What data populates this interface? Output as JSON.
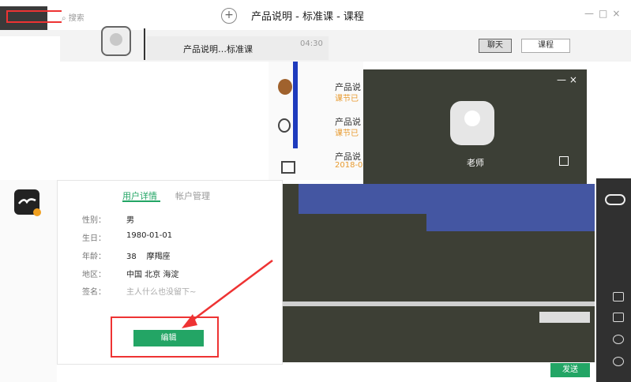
{
  "search": {
    "placeholder": "搜索"
  },
  "window": {
    "title": "产品说明 - 标准课 - 课程"
  },
  "conversation": {
    "name": "产品说明…标准课",
    "time": "04:30"
  },
  "header_tabs": [
    "聊天",
    "课程"
  ],
  "list_items": [
    {
      "title": "产品说",
      "sub": "课节已"
    },
    {
      "title": "产品说",
      "sub": "课节已"
    },
    {
      "title": "产品说",
      "sub": "2018-0"
    }
  ],
  "video": {
    "name": "老师",
    "controls": "— ×"
  },
  "profile": {
    "tabs": {
      "detail": "用户详情",
      "account": "帐户管理"
    },
    "fields": [
      {
        "label": "性别：",
        "value": "男"
      },
      {
        "label": "生日：",
        "value": "1980-01-01"
      },
      {
        "label": "年龄：",
        "value": "38    摩羯座"
      },
      {
        "label": "地区：",
        "value": "中国 北京 海淀"
      },
      {
        "label": "签名：",
        "value": "主人什么也没留下~"
      }
    ],
    "edit_label": "编辑"
  },
  "chat": {
    "send_label": "发送"
  },
  "colors": {
    "accent": "#23a565",
    "highlight": "#e33333",
    "dark": "#3d3f35",
    "band": "#4456a2"
  }
}
